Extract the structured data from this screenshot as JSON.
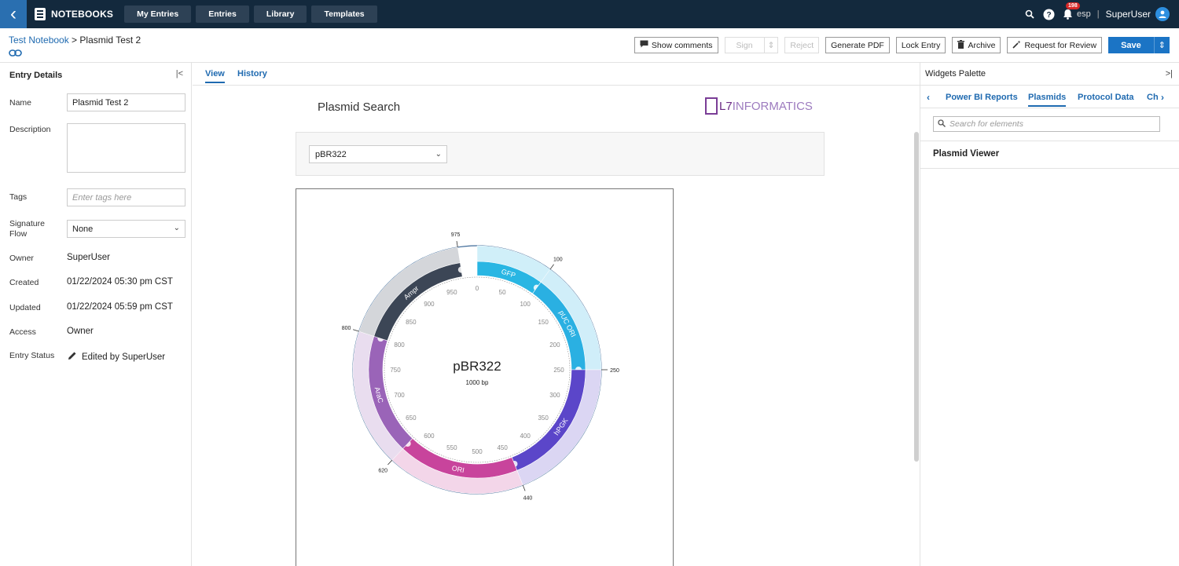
{
  "topbar": {
    "app_name": "NOTEBOOKS",
    "nav": [
      "My Entries",
      "Entries",
      "Library",
      "Templates"
    ],
    "notif_count": "198",
    "lang": "esp",
    "user": "SuperUser"
  },
  "header": {
    "notebook": "Test Notebook",
    "separator": " > ",
    "entry": "Plasmid Test 2",
    "buttons": {
      "comments": "Show comments",
      "sign": "Sign",
      "reject": "Reject",
      "pdf": "Generate PDF",
      "lock": "Lock Entry",
      "archive": "Archive",
      "review": "Request for Review",
      "save": "Save"
    }
  },
  "details": {
    "title": "Entry Details",
    "labels": {
      "name": "Name",
      "description": "Description",
      "tags": "Tags",
      "signature": "Signature Flow",
      "owner": "Owner",
      "created": "Created",
      "updated": "Updated",
      "access": "Access",
      "status": "Entry Status"
    },
    "name": "Plasmid Test 2",
    "tags_placeholder": "Enter tags here",
    "signature_flow": "None",
    "owner": "SuperUser",
    "created": "01/22/2024 05:30 pm CST",
    "updated": "01/22/2024 05:59 pm CST",
    "access": "Owner",
    "status": "Edited by SuperUser"
  },
  "center": {
    "tabs": [
      "View",
      "History"
    ],
    "title": "Plasmid Search",
    "logo_l7": "L7",
    "logo_rest": "INFORMATICS",
    "selected_plasmid": "pBR322"
  },
  "plasmid_map": {
    "name": "pBR322",
    "length_label": "1000 bp",
    "length": 1000,
    "features": [
      {
        "label": "GFP",
        "start": 0,
        "end": 100,
        "color": "#29b6e3"
      },
      {
        "label": "pUC ORI",
        "start": 100,
        "end": 250,
        "color": "#2ab0e2"
      },
      {
        "label": "hPGK",
        "start": 250,
        "end": 440,
        "color": "#5b46c9"
      },
      {
        "label": "ORI",
        "start": 440,
        "end": 620,
        "color": "#c8449c"
      },
      {
        "label": "AraC",
        "start": 620,
        "end": 800,
        "color": "#9a64b8"
      },
      {
        "label": "Ampr",
        "start": 800,
        "end": 975,
        "color": "#3c4656"
      }
    ],
    "outer_ticks": [
      "975",
      "100",
      "250",
      "440",
      "620",
      "800"
    ],
    "inner_ticks": [
      "0",
      "50",
      "100",
      "150",
      "200",
      "250",
      "300",
      "350",
      "400",
      "450",
      "500",
      "550",
      "600",
      "650",
      "700",
      "750",
      "800",
      "850",
      "900",
      "950"
    ]
  },
  "palette": {
    "title": "Widgets Palette",
    "tabs": [
      "Power BI Reports",
      "Plasmids",
      "Protocol Data",
      "Ch"
    ],
    "search_placeholder": "Search for elements",
    "item": "Plasmid Viewer"
  }
}
